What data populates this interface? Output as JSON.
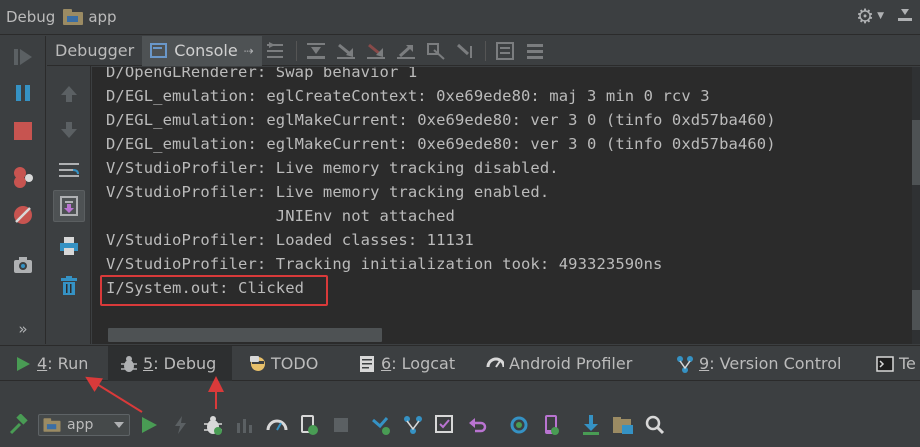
{
  "window": {
    "title": "Debug",
    "module": "app"
  },
  "tabs": {
    "debugger": "Debugger",
    "console": "Console"
  },
  "console_lines": [
    "D/OpenGLRenderer: Swap behavior 1",
    "D/EGL_emulation: eglCreateContext: 0xe69ede80: maj 3 min 0 rcv 3",
    "D/EGL_emulation: eglMakeCurrent: 0xe69ede80: ver 3 0 (tinfo 0xd57ba460)",
    "D/EGL_emulation: eglMakeCurrent: 0xe69ede80: ver 3 0 (tinfo 0xd57ba460)",
    "V/StudioProfiler: Live memory tracking disabled.",
    "V/StudioProfiler: Live memory tracking enabled.",
    "                  JNIEnv not attached",
    "V/StudioProfiler: Loaded classes: 11131",
    "V/StudioProfiler: Tracking initialization took: 493323590ns",
    "I/System.out: Clicked"
  ],
  "bottom_tabs": {
    "run": {
      "key": "4",
      "label": ": Run"
    },
    "debug": {
      "key": "5",
      "label": ": Debug"
    },
    "todo": {
      "label": "TODO"
    },
    "logcat": {
      "key": "6",
      "label": ": Logcat"
    },
    "profiler": {
      "label": "Android Profiler"
    },
    "vcs": {
      "key": "9",
      "label": ": Version Control"
    },
    "terminal": {
      "label": "Te"
    }
  },
  "toolbar": {
    "config_select": "app",
    "expand_label": "»"
  },
  "colors": {
    "background": "#3c3f41",
    "console_bg": "#2b2b2b",
    "annotation_red": "#d93a3a",
    "run_green": "#499c54",
    "stop_red": "#c75450",
    "accent_blue": "#3592c4"
  }
}
